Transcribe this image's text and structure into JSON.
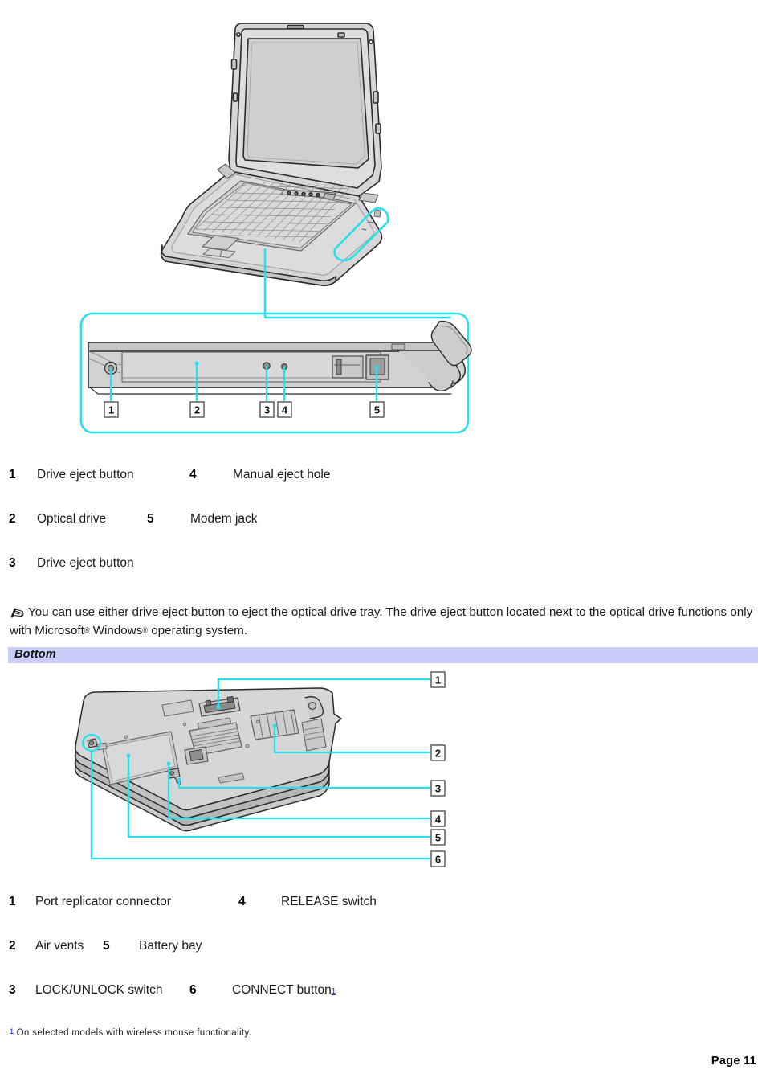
{
  "page": {
    "page_label": "Page 11",
    "accent_color": "#26e0ee",
    "band_color": "#ccccfa",
    "illustration_fill": "#d4d4d4"
  },
  "figure_right_side": {
    "name": "right-side-view",
    "callout_numbers": [
      "1",
      "2",
      "3",
      "4",
      "5"
    ]
  },
  "legend_right_side": {
    "rows": [
      {
        "left_num": "1",
        "left_label": "Drive eject button",
        "right_num": "4",
        "right_label": "Manual eject hole"
      },
      {
        "left_num": "2",
        "left_label": "Optical drive",
        "right_num": "5",
        "right_label": "Modem jack"
      },
      {
        "left_num": "3",
        "left_label": "Drive eject button",
        "right_num": "",
        "right_label": ""
      }
    ]
  },
  "note": {
    "icon": "note-pencil-icon",
    "text_part1": "You can use either drive eject button to eject the optical drive tray. The drive eject button located next to the optical drive functions only with Microsoft",
    "reg1": "®",
    "text_part2": " Windows",
    "reg2": "®",
    "text_part3": " operating system."
  },
  "section_bottom": {
    "title": "Bottom"
  },
  "figure_bottom": {
    "name": "bottom-view",
    "callout_numbers": [
      "1",
      "2",
      "3",
      "4",
      "5",
      "6"
    ]
  },
  "legend_bottom": {
    "rows": [
      {
        "left_num": "1",
        "left_label": "Port replicator connector",
        "right_num": "4",
        "right_label": "RELEASE switch"
      },
      {
        "left_num": "2",
        "left_label": "Air vents",
        "right_num": "5",
        "right_label": "Battery bay"
      },
      {
        "left_num": "3",
        "left_label": "LOCK/UNLOCK switch",
        "right_num": "6",
        "right_label": "CONNECT button",
        "right_footnote": "1"
      }
    ]
  },
  "footnote": {
    "marker": "1",
    "text": "On selected models with wireless mouse functionality."
  }
}
